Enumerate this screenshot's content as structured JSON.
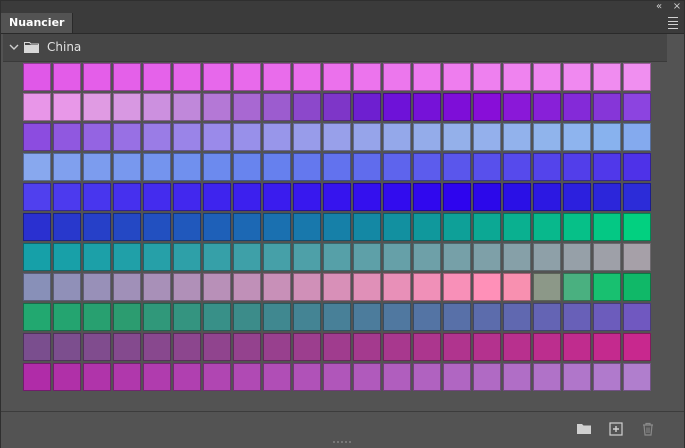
{
  "window": {
    "collapse_glyph": "«",
    "close_glyph": "×"
  },
  "panel": {
    "tab_label": "Nuancier",
    "menu_icon": "hamburger-menu-icon"
  },
  "group": {
    "name": "China",
    "expanded": true,
    "icon": "folder-icon"
  },
  "swatches": [
    "#e058e8",
    "#e35ce8",
    "#e45ee9",
    "#e460e9",
    "#e562ea",
    "#e665ea",
    "#e768eb",
    "#e86aeb",
    "#e96ceb",
    "#ea6eec",
    "#eb71ec",
    "#ec74ed",
    "#ec77ed",
    "#ed7aee",
    "#ee7dee",
    "#ee80ef",
    "#ef83ef",
    "#ef86f0",
    "#f089f0",
    "#f08cf0",
    "#f08ff0",
    "#e896e8",
    "#e898e8",
    "#e09be3",
    "#d898e2",
    "#cc90df",
    "#c088da",
    "#b478d6",
    "#a868d2",
    "#9c5ccf",
    "#8c48cb",
    "#7e36c8",
    "#6e1fd0",
    "#6e12d8",
    "#7612d8",
    "#7e0ed8",
    "#880ed8",
    "#8a18d8",
    "#8820d8",
    "#842ad8",
    "#8636d8",
    "#8c44e0",
    "#8c4ce0",
    "#9058e0",
    "#9464e2",
    "#9870e4",
    "#9a7ce6",
    "#9a84e8",
    "#9a8aea",
    "#9890ea",
    "#9896ea",
    "#989cea",
    "#98a0ea",
    "#96a4ea",
    "#94a8ea",
    "#94acea",
    "#94b0ea",
    "#94b0ec",
    "#92b2ec",
    "#90b4ec",
    "#8eb4ee",
    "#88b2ee",
    "#84aaee",
    "#88a8ee",
    "#80a0ee",
    "#7c9cee",
    "#7898ee",
    "#7494ee",
    "#7090ee",
    "#6c8aee",
    "#6884ee",
    "#6680ee",
    "#6478ee",
    "#6272ee",
    "#606ced",
    "#5e64ed",
    "#5c5ced",
    "#5a56ec",
    "#5850ec",
    "#564aec",
    "#5444eb",
    "#523eea",
    "#5038ea",
    "#4e32e8",
    "#5040ee",
    "#4c3aee",
    "#4836ee",
    "#4630ee",
    "#442cee",
    "#4228ee",
    "#3e24ee",
    "#3c20ee",
    "#3a1cee",
    "#3818ee",
    "#3614ee",
    "#3410ee",
    "#320cee",
    "#3008ee",
    "#2e04ee",
    "#2c08ea",
    "#2a10e6",
    "#2c18e2",
    "#2c20de",
    "#2c26da",
    "#2c2cd8",
    "#2a30d0",
    "#2838cc",
    "#2640c8",
    "#2448c4",
    "#2250c0",
    "#2058bc",
    "#1e60b8",
    "#1c68b4",
    "#1a70b0",
    "#1878ac",
    "#1680a8",
    "#1488a4",
    "#1290a0",
    "#10989c",
    "#0ea098",
    "#0ca894",
    "#0ab090",
    "#08b88c",
    "#06c088",
    "#04c884",
    "#02d080",
    "#16a0a8",
    "#18a0a8",
    "#1ca0a8",
    "#20a0a8",
    "#26a0a8",
    "#2ea0a8",
    "#36a0a8",
    "#3ea0a8",
    "#46a0a8",
    "#4ea0a8",
    "#56a0a8",
    "#5ea0a8",
    "#66a0a8",
    "#6ea0a8",
    "#76a0a8",
    "#7ea0a8",
    "#86a0a8",
    "#8ea0a8",
    "#96a0a8",
    "#9ea0a8",
    "#a6a0a8",
    "#8890b8",
    "#9090b8",
    "#9890b8",
    "#a090b8",
    "#a890b8",
    "#b090b8",
    "#b890b8",
    "#c090b8",
    "#c890b8",
    "#d090b8",
    "#d890b8",
    "#e090b8",
    "#e890b8",
    "#f090b8",
    "#f890b8",
    "#ff90b8",
    "#f890b0",
    "#8c9888",
    "#4ab080",
    "#18c070",
    "#10b868",
    "#22a870",
    "#24a470",
    "#28a070",
    "#2c9c70",
    "#30987a",
    "#349480",
    "#389088",
    "#3c8c8a",
    "#408890",
    "#448494",
    "#488098",
    "#4c7c9c",
    "#5078a0",
    "#5474a4",
    "#5870a8",
    "#5c6cac",
    "#6068b0",
    "#6464b4",
    "#6860b8",
    "#6c5cbc",
    "#7058c0",
    "#7a4e8e",
    "#7c4e8e",
    "#804c8e",
    "#844a8e",
    "#88488e",
    "#8c468e",
    "#90448e",
    "#94428e",
    "#98408e",
    "#9c3e8e",
    "#a03c8e",
    "#a43a8e",
    "#a8388e",
    "#ac368e",
    "#b0348e",
    "#b4328e",
    "#b8308e",
    "#bc2e8e",
    "#c02c8e",
    "#c42a8e",
    "#c8288e",
    "#b02ca8",
    "#b030a8",
    "#b034aa",
    "#b038ac",
    "#b03cae",
    "#b040b0",
    "#b046b2",
    "#b04ab4",
    "#b04eb6",
    "#b052b8",
    "#b056ba",
    "#b05abc",
    "#b05ebe",
    "#b062c0",
    "#b066c2",
    "#b06ac4",
    "#b06ec6",
    "#b072c8",
    "#b076ca",
    "#b07acc",
    "#b07ecd"
  ],
  "toolbar": {
    "new_group_icon": "folder-icon",
    "new_swatch_icon": "add-swatch-icon",
    "delete_icon": "trash-icon"
  }
}
